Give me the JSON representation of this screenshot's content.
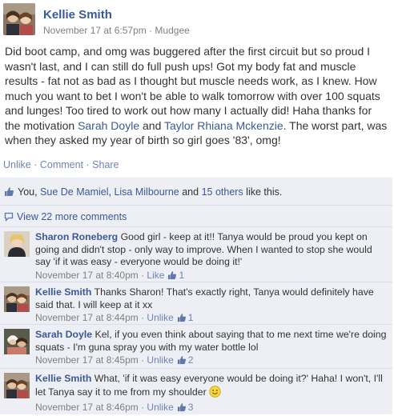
{
  "post": {
    "author": "Kellie Smith",
    "timestamp": "November 17 at 6:57pm",
    "separator": " · ",
    "location": "Mudgee",
    "text_main": "Did boot camp, and omg was buggered after the first circuit but so proud I wasn't last, and I can still do full push ups! Got my body fat and muscle results - fat not as bad as I thought but muscle needs work, as I knew. How much you want to bet I won't be able to walk tomorrow with over 100 squats and lunges! Too tired to work out how many I actually did! Haha thanks for the motivation ",
    "tag1": "Sarah Doyle",
    "and_word": " and ",
    "tag2": "Taylor Rhiana Mckenzie",
    "text_tail": ". The worst part, was when they asked my year of birth so girl goes '83', omg!",
    "actions": {
      "unlike": "Unlike",
      "comment": "Comment",
      "share": "Share",
      "sep": " · "
    }
  },
  "likes": {
    "you": "You, ",
    "person1": "Sue De Mamiel",
    "comma": ", ",
    "person2": "Lisa Milbourne",
    "and_word": " and ",
    "others": "15 others",
    "suffix": " like this."
  },
  "view_more": "View 22 more comments",
  "comments": [
    {
      "author": "Sharon Roneberg",
      "text": " Good girl - keep at it!! Tanya would be proud you kept on going and didn't stop - only way to improve. When I wanted to stop she would say 'if it was easy - everyone would be doing it!'",
      "time": "November 17 at 8:40pm",
      "action": "Like",
      "like_count": "1"
    },
    {
      "author": "Kellie Smith",
      "text": " Thanks Sharon! That's exactly right, Tanya would definitely have said that. I will keep at it xx",
      "time": "November 17 at 8:44pm",
      "action": "Unlike",
      "like_count": "1"
    },
    {
      "author": "Sarah Doyle",
      "text": " Kel, if you even think about saying that to me next time we're doing squats - I'm guna spray you with my water bottle lol",
      "time": "November 17 at 8:45pm",
      "action": "Unlike",
      "like_count": "2"
    },
    {
      "author": "Kellie Smith",
      "text": " What, 'if it was easy everyone would be doing it?' Haha! I won't, I'll let Tanya say it to me from my shoulder ",
      "time": "November 17 at 8:46pm",
      "action": "Unlike",
      "like_count": "3"
    }
  ],
  "meta_sep": " · ",
  "colors": {
    "link": "#3b5998",
    "action_link": "#6d84b4",
    "muted": "#808080",
    "feedback_bg": "#edeff4",
    "divider": "#d8dfea"
  },
  "icons": {
    "like": "thumbs-up-icon",
    "comment": "speech-bubble-icon",
    "smiley": "smiley-emoticon-icon"
  }
}
